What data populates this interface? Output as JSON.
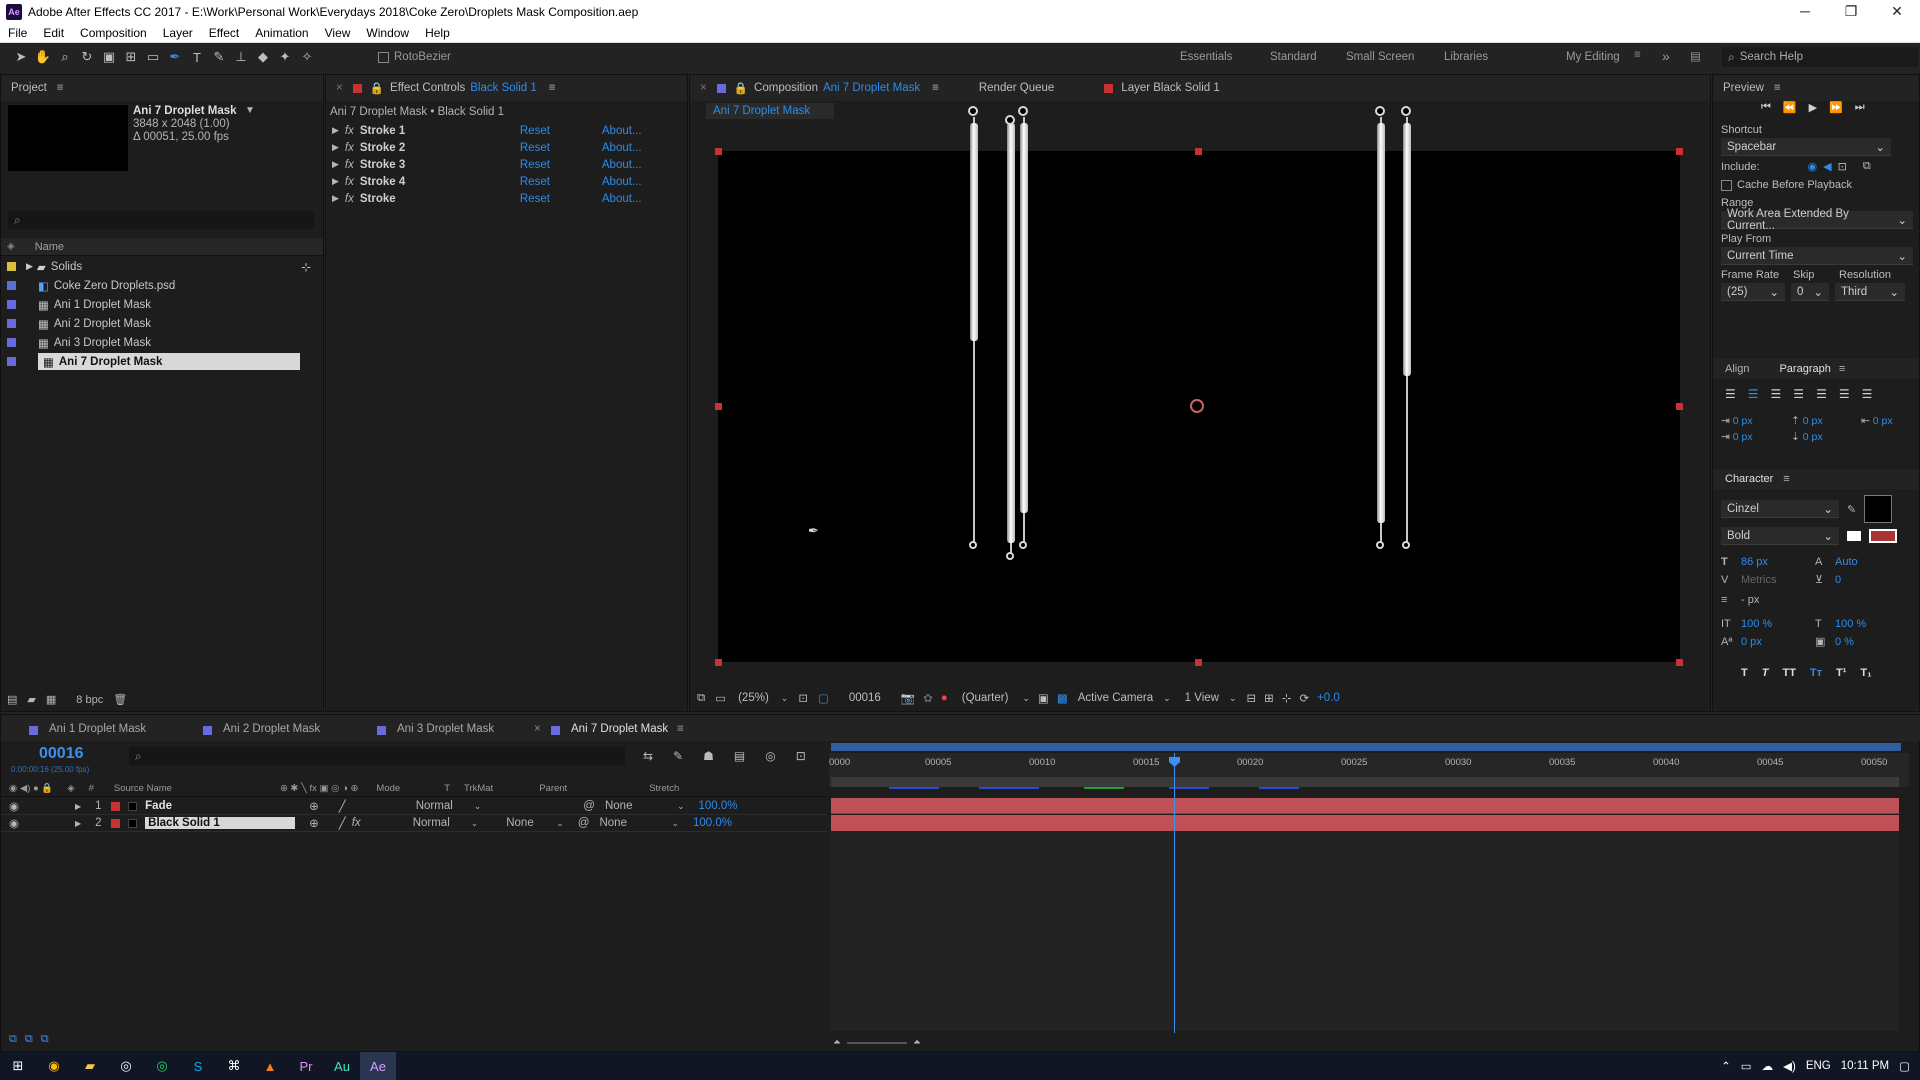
{
  "window": {
    "app_icon": "Ae",
    "title": "Adobe After Effects CC 2017 - E:\\Work\\Personal Work\\Everydays 2018\\Coke Zero\\Droplets Mask Composition.aep",
    "minimize": "─",
    "maximize": "❐",
    "close": "✕"
  },
  "menu": [
    "File",
    "Edit",
    "Composition",
    "Layer",
    "Effect",
    "Animation",
    "View",
    "Window",
    "Help"
  ],
  "toolbar": {
    "rotobezier_label": "RotoBezier",
    "workspaces": [
      "Essentials",
      "Standard",
      "Small Screen",
      "Libraries",
      "My Editing"
    ],
    "active_workspace": "My Editing",
    "search_placeholder": "Search Help"
  },
  "project": {
    "title": "Project",
    "selected_name": "Ani 7 Droplet Mask",
    "dims": "3848 x 2048 (1.00)",
    "duration": "Δ 00051, 25.00 fps",
    "col_name": "Name",
    "items": [
      {
        "label": "Solids",
        "color": "#d9c23a",
        "type": "folder"
      },
      {
        "label": "Coke Zero Droplets.psd",
        "color": "#5b6fd9",
        "type": "psd"
      },
      {
        "label": "Ani 1 Droplet Mask",
        "color": "#6a6ae0",
        "type": "comp"
      },
      {
        "label": "Ani 2 Droplet Mask",
        "color": "#6a6ae0",
        "type": "comp"
      },
      {
        "label": "Ani 3 Droplet Mask",
        "color": "#6a6ae0",
        "type": "comp"
      },
      {
        "label": "Ani 7 Droplet Mask",
        "color": "#6a6ae0",
        "type": "comp"
      }
    ],
    "bpc": "8 bpc"
  },
  "effects": {
    "tab_prefix": "Effect Controls",
    "tab_layer": "Black Solid 1",
    "breadcrumb": "Ani 7 Droplet Mask • Black Solid 1",
    "rows": [
      {
        "name": "Stroke 1",
        "reset": "Reset",
        "about": "About..."
      },
      {
        "name": "Stroke 2",
        "reset": "Reset",
        "about": "About..."
      },
      {
        "name": "Stroke 3",
        "reset": "Reset",
        "about": "About..."
      },
      {
        "name": "Stroke 4",
        "reset": "Reset",
        "about": "About..."
      },
      {
        "name": "Stroke",
        "reset": "Reset",
        "about": "About..."
      }
    ]
  },
  "viewer": {
    "tab_prefix": "Composition",
    "tab_comp": "Ani 7 Droplet Mask",
    "render_queue": "Render Queue",
    "layer_tab": "Layer Black Solid 1",
    "comp_crumb": "Ani 7 Droplet Mask",
    "zoom": "(25%)",
    "timecode": "00016",
    "resolution": "(Quarter)",
    "camera": "Active Camera",
    "views": "1 View",
    "exposure": "+0.0"
  },
  "preview": {
    "title": "Preview",
    "shortcut_label": "Shortcut",
    "shortcut_value": "Spacebar",
    "include_label": "Include:",
    "cache_label": "Cache Before Playback",
    "range_label": "Range",
    "range_value": "Work Area Extended By Current...",
    "play_from_label": "Play From",
    "play_from_value": "Current Time",
    "frame_rate_label": "Frame Rate",
    "skip_label": "Skip",
    "resolution_label": "Resolution",
    "frame_rate_value": "(25)",
    "skip_value": "0",
    "resolution_value": "Third"
  },
  "paragraph": {
    "align_tab": "Align",
    "paragraph_tab": "Paragraph",
    "indent_left": "0 px",
    "indent_first": "0 px",
    "space_before": "0 px",
    "space_after": "0 px",
    "indent_right": "0 px"
  },
  "character": {
    "title": "Character",
    "font": "Cinzel",
    "style": "Bold",
    "size": "86 px",
    "leading": "Auto",
    "kerning": "Metrics",
    "tracking": "0",
    "stroke_width": "- px",
    "vscale": "100 %",
    "hscale": "100 %",
    "baseline": "0 px",
    "tsume": "0 %"
  },
  "timeline": {
    "tabs": [
      "Ani 1 Droplet Mask",
      "Ani 2 Droplet Mask",
      "Ani 3 Droplet Mask",
      "Ani 7 Droplet Mask"
    ],
    "timecode": "00016",
    "timecode_sub": "0:00:00:16 (25.00 fps)",
    "headers": {
      "source": "Source Name",
      "mode": "Mode",
      "t": "T",
      "trkmat": "TrkMat",
      "parent": "Parent",
      "stretch": "Stretch"
    },
    "ruler": [
      "0000",
      "00005",
      "00010",
      "00015",
      "00020",
      "00025",
      "00030",
      "00035",
      "00040",
      "00045",
      "00050"
    ],
    "layers": [
      {
        "num": "1",
        "name": "Fade",
        "mode": "Normal",
        "trkmat": "",
        "parent": "None",
        "stretch": "100.0%"
      },
      {
        "num": "2",
        "name": "Black Solid 1",
        "mode": "Normal",
        "trkmat": "None",
        "parent": "None",
        "stretch": "100.0%"
      }
    ]
  },
  "taskbar": {
    "lang": "ENG",
    "time": "10:11 PM"
  }
}
